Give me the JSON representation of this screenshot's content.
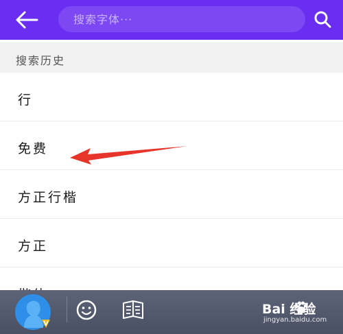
{
  "header": {
    "back_icon": "arrow-left-icon",
    "search_placeholder": "搜索字体···",
    "search_icon": "search-icon",
    "background_color": "#6a2ef0"
  },
  "history": {
    "title": "搜索历史",
    "items": [
      {
        "label": "行"
      },
      {
        "label": "免费"
      },
      {
        "label": "方正行楷"
      },
      {
        "label": "方正"
      },
      {
        "label": "楷体"
      }
    ]
  },
  "annotation": {
    "arrow_color": "#e8352b",
    "arrow_icon": "red-arrow-icon"
  },
  "bottom_bar": {
    "avatar_icon": "user-avatar-icon",
    "emoji_icon": "smiley-icon",
    "book_icon": "book-icon",
    "watermark_main": "Bai  经验",
    "watermark_sub": "jingyan.baidu.com"
  }
}
